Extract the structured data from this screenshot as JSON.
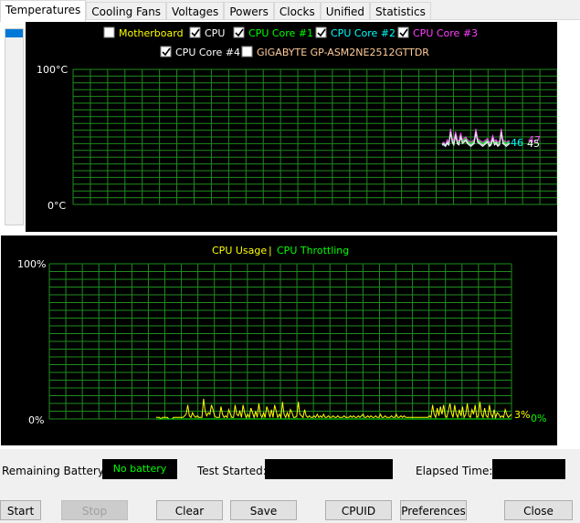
{
  "tabs": [
    "Temperatures",
    "Cooling Fans",
    "Voltages",
    "Powers",
    "Clocks",
    "Unified",
    "Statistics"
  ],
  "temp_chart": {
    "legend": [
      {
        "label": "Motherboard",
        "checked": false,
        "color": "#ffff00"
      },
      {
        "label": "CPU",
        "checked": true,
        "color": "#ffffff"
      },
      {
        "label": "CPU Core #1",
        "checked": true,
        "color": "#00ff00"
      },
      {
        "label": "CPU Core #2",
        "checked": true,
        "color": "#00ffff"
      },
      {
        "label": "CPU Core #3",
        "checked": true,
        "color": "#ff40ff"
      },
      {
        "label": "CPU Core #4",
        "checked": true,
        "color": "#ffffff"
      },
      {
        "label": "GIGABYTE GP-ASM2NE2512GTTDR",
        "checked": false,
        "color": "#ffcc99"
      }
    ],
    "y_max_label": "100°C",
    "y_min_label": "0°C",
    "end_labels": [
      {
        "text": "46",
        "color": "#00ffff"
      },
      {
        "text": "47",
        "color": "#ff40ff"
      },
      {
        "text": "45",
        "color": "#ffffff"
      }
    ]
  },
  "chart_data": {
    "type": "line",
    "title": "",
    "series": [
      {
        "name": "CPU Usage",
        "color": "#ffff00",
        "values": [
          1,
          1,
          1,
          0,
          1,
          1,
          1,
          1,
          0,
          0,
          0,
          1,
          1,
          1,
          1,
          1,
          1,
          1,
          2,
          3,
          9,
          2,
          1,
          4,
          2,
          1,
          2,
          1,
          1,
          1,
          13,
          5,
          2,
          4,
          3,
          9,
          6,
          2,
          1,
          1,
          1,
          8,
          3,
          1,
          2,
          1,
          6,
          3,
          1,
          1,
          9,
          3,
          2,
          5,
          1,
          9,
          4,
          1,
          3,
          1,
          7,
          4,
          1,
          5,
          1,
          10,
          3,
          1,
          4,
          1,
          8,
          5,
          1,
          6,
          1,
          9,
          5,
          1,
          3,
          1,
          11,
          3,
          1,
          4,
          1,
          6,
          4,
          1,
          1,
          2,
          11,
          3,
          2,
          1,
          6,
          2,
          1,
          2,
          1,
          1,
          2,
          1,
          3,
          1,
          2,
          1,
          3,
          1,
          1,
          2,
          1,
          1,
          2,
          1,
          1,
          2,
          1,
          1,
          1,
          2,
          1,
          1,
          1,
          2,
          1,
          2,
          1,
          1,
          2,
          1,
          2,
          3,
          1,
          1,
          2,
          1,
          2,
          1,
          1,
          2,
          1,
          1,
          3,
          1,
          1,
          2,
          1,
          1,
          1,
          2,
          1,
          1,
          3,
          1,
          1,
          2,
          1,
          2,
          1,
          1,
          1,
          1,
          1,
          1,
          1,
          1,
          1,
          1,
          1,
          1,
          1,
          1,
          1,
          2,
          1,
          9,
          3,
          1,
          7,
          2,
          8,
          3,
          9,
          2,
          1,
          5,
          10,
          4,
          1,
          9,
          3,
          1,
          6,
          2,
          8,
          1,
          3,
          10,
          2,
          1,
          6,
          3,
          9,
          1,
          2,
          11,
          3,
          1,
          7,
          2,
          1,
          9,
          3,
          1,
          6,
          1,
          4,
          3,
          1,
          2,
          1,
          6,
          3,
          1,
          2,
          3
        ]
      },
      {
        "name": "CPU Throttling",
        "color": "#00ff00",
        "values": [
          0
        ]
      }
    ],
    "ylim": [
      0,
      100
    ],
    "y_max_label": "100%",
    "y_min_label": "0%",
    "end_labels": [
      {
        "text": "3%",
        "color": "#ffff00"
      },
      {
        "text": "0%",
        "color": "#00ff00"
      }
    ]
  },
  "temp_series": {
    "core1": [
      45,
      46,
      44,
      47,
      45,
      55,
      48,
      46,
      53,
      47,
      46,
      52,
      47,
      48,
      49,
      47,
      46,
      45,
      46,
      47,
      55,
      48,
      47,
      46,
      45,
      46,
      47,
      48,
      45,
      46,
      50,
      46,
      47,
      45,
      46,
      55,
      47,
      46,
      45,
      46,
      47
    ],
    "core2": [
      44,
      45,
      43,
      46,
      44,
      54,
      47,
      45,
      52,
      46,
      45,
      51,
      46,
      47,
      48,
      46,
      45,
      44,
      45,
      46,
      54,
      47,
      46,
      45,
      44,
      45,
      46,
      47,
      44,
      45,
      49,
      45,
      46,
      44,
      45,
      54,
      46,
      45,
      44,
      45,
      46
    ],
    "core3": [
      45,
      46,
      44,
      48,
      46,
      56,
      49,
      47,
      54,
      48,
      47,
      53,
      48,
      49,
      50,
      48,
      47,
      46,
      47,
      48,
      56,
      49,
      48,
      47,
      46,
      47,
      48,
      49,
      46,
      47,
      51,
      47,
      48,
      46,
      47,
      56,
      48,
      47,
      46,
      47,
      47
    ],
    "core4": [
      44,
      44,
      43,
      45,
      44,
      53,
      46,
      44,
      51,
      45,
      44,
      50,
      45,
      46,
      47,
      45,
      44,
      43,
      44,
      45,
      53,
      46,
      45,
      44,
      43,
      44,
      45,
      46,
      43,
      44,
      48,
      44,
      45,
      43,
      44,
      53,
      45,
      44,
      43,
      44,
      45
    ],
    "cpu": [
      45,
      45,
      44,
      46,
      45,
      54,
      47,
      45,
      52,
      46,
      45,
      51,
      46,
      47,
      48,
      46,
      45,
      44,
      45,
      46,
      54,
      47,
      46,
      45,
      44,
      45,
      46,
      47,
      44,
      45,
      49,
      45,
      46,
      44,
      45,
      54,
      46,
      45,
      44,
      45,
      45
    ]
  },
  "cpu_chart_legend": [
    {
      "label": "CPU Usage",
      "color": "#ffff00"
    },
    {
      "label": "CPU Throttling",
      "color": "#00ff00"
    }
  ],
  "status": {
    "remaining_battery_label": "Remaining Battery:",
    "remaining_battery_value": "No battery",
    "test_started_label": "Test Started:",
    "test_started_value": "",
    "elapsed_time_label": "Elapsed Time:",
    "elapsed_time_value": ""
  },
  "buttons": {
    "start": "Start",
    "stop": "Stop",
    "clear": "Clear",
    "save": "Save",
    "cpuid": "CPUID",
    "preferences": "Preferences",
    "close": "Close"
  }
}
